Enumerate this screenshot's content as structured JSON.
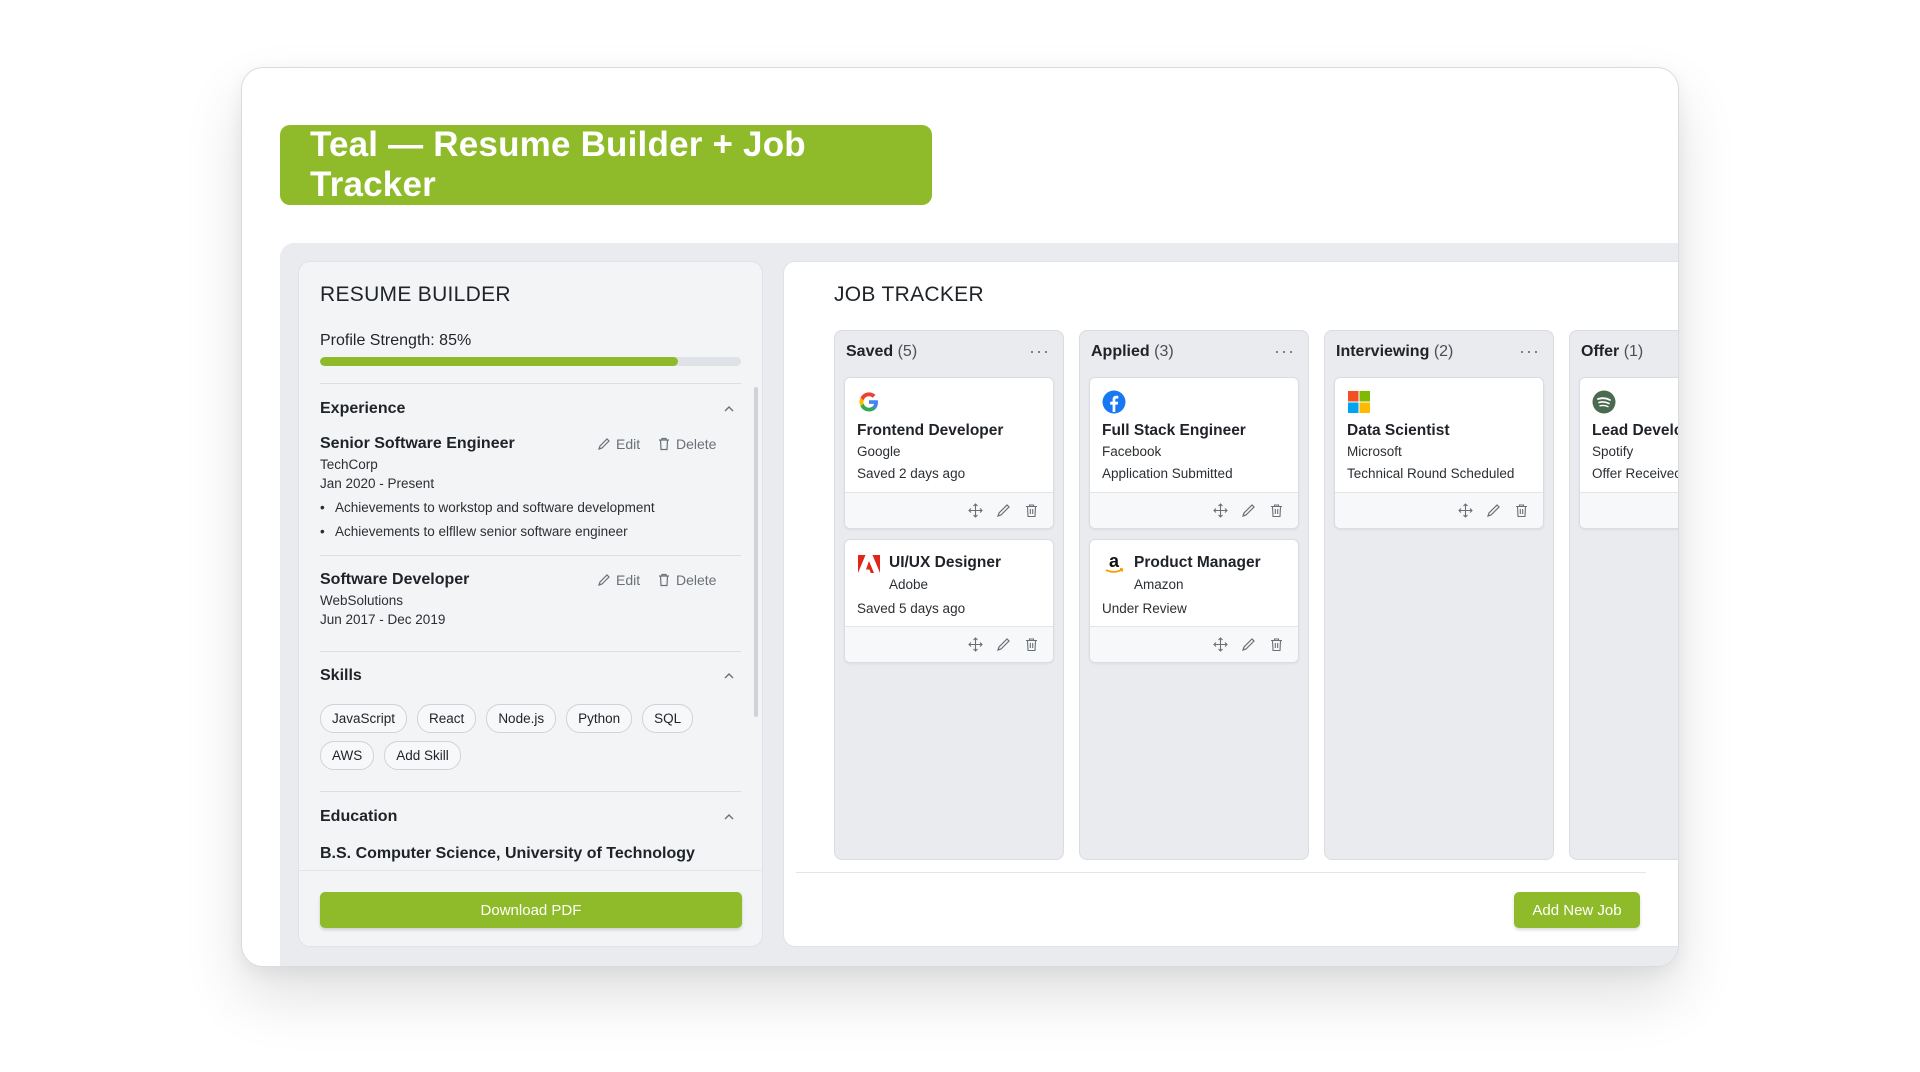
{
  "banner": {
    "title": "Teal — Resume Builder + Job Tracker"
  },
  "resume": {
    "heading": "RESUME BUILDER",
    "strength_label": "Profile Strength: 85%",
    "strength_value": 0.85,
    "experience": {
      "title": "Experience",
      "items": [
        {
          "title": "Senior Software Engineer",
          "company": "TechCorp",
          "dates": "Jan 2020 - Present",
          "bullets": [
            "Achievements to workstop and software development",
            "Achievements to elfllew senior software engineer"
          ],
          "edit_label": "Edit",
          "delete_label": "Delete"
        },
        {
          "title": "Software Developer",
          "company": "WebSolutions",
          "dates": "Jun 2017 - Dec 2019",
          "edit_label": "Edit",
          "delete_label": "Delete"
        }
      ]
    },
    "skills": {
      "title": "Skills",
      "items": [
        "JavaScript",
        "React",
        "Node.js",
        "Python",
        "SQL",
        "AWS",
        "Add Skill"
      ]
    },
    "education": {
      "title": "Education",
      "line": "B.S. Computer Science, University of Technology"
    },
    "download_label": "Download PDF"
  },
  "tracker": {
    "heading": "JOB TRACKER",
    "columns": [
      {
        "name": "Saved",
        "count": "(5)",
        "cards": [
          {
            "logo": "google-logo",
            "title": "Frontend Developer",
            "company": "Google",
            "status": "Saved 2 days ago"
          },
          {
            "logo": "adobe-logo",
            "title": "UI/UX Designer",
            "company": "Adobe",
            "status": "Saved 5 days ago"
          }
        ]
      },
      {
        "name": "Applied",
        "count": "(3)",
        "cards": [
          {
            "logo": "facebook-logo",
            "title": "Full Stack Engineer",
            "company": "Facebook",
            "status": "Application Submitted"
          },
          {
            "logo": "amazon-logo",
            "title": "Product Manager",
            "company": "Amazon",
            "status": "Under Review"
          }
        ]
      },
      {
        "name": "Interviewing",
        "count": "(2)",
        "cards": [
          {
            "logo": "microsoft-logo",
            "title": "Data Scientist",
            "company": "Microsoft",
            "status": "Technical Round Scheduled"
          }
        ]
      },
      {
        "name": "Offer",
        "count": "(1)",
        "cards": [
          {
            "logo": "spotify-logo",
            "title": "Lead Develc",
            "company": "Spotify",
            "status": "Offer Receivec"
          }
        ]
      }
    ],
    "column_menu": "···",
    "add_job_label": "Add New Job"
  },
  "colors": {
    "accent": "#8fbb2a",
    "panel_bg": "#f3f4f6",
    "workspace_bg": "#e9ebee"
  }
}
